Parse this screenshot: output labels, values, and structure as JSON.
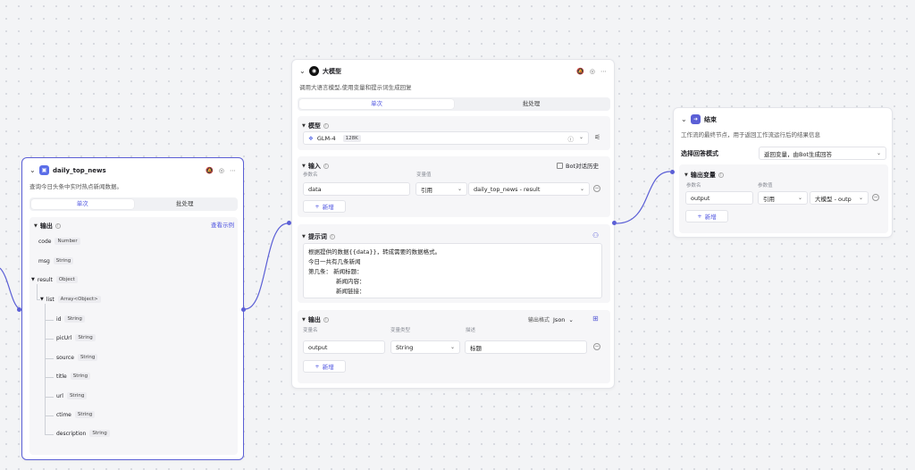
{
  "colors": {
    "accent": "#5b5fd6",
    "link": "#4d53e0",
    "edge": "#5b5fd6"
  },
  "node1": {
    "title": "daily_top_news",
    "icon": "plugin-icon",
    "desc": "查询今日头条中实时热点新闻数据。",
    "tabs": [
      "单次",
      "批处理"
    ],
    "output_title": "输出",
    "view_example": "查看示例",
    "fields": [
      {
        "name": "code",
        "type": "Number"
      },
      {
        "name": "msg",
        "type": "String"
      },
      {
        "name": "result",
        "type": "Object"
      },
      {
        "name": "list",
        "type": "Array<Object>"
      },
      {
        "name": "id",
        "type": "String"
      },
      {
        "name": "picUrl",
        "type": "String"
      },
      {
        "name": "source",
        "type": "String"
      },
      {
        "name": "title",
        "type": "String"
      },
      {
        "name": "url",
        "type": "String"
      },
      {
        "name": "ctime",
        "type": "String"
      },
      {
        "name": "description",
        "type": "String"
      }
    ]
  },
  "node2": {
    "title": "大模型",
    "desc": "调用大语言模型,使用变量和提示词生成回复",
    "tabs": [
      "单次",
      "批处理"
    ],
    "model_title": "模型",
    "model_name": "GLM-4",
    "model_ctx": "128K",
    "input_title": "输入",
    "bot_history": "Bot对话历史",
    "param_label": "参数名",
    "value_label": "变量值",
    "input_param": "data",
    "input_ref": "引用",
    "input_value": "daily_top_news - result",
    "add": "新增",
    "prompt_title": "提示词",
    "prompt_lines": [
      "根据提供的数据{{data}}，转成需要的数据格式。",
      "今日一共有几条新闻",
      "第几条： 新闻标题：",
      "新闻内容：",
      "新闻链接："
    ],
    "output_title": "输出",
    "output_format_label": "输出格式",
    "output_format": "Json",
    "var_label": "变量名",
    "type_label": "变量类型",
    "desc_label": "描述",
    "output_name": "output",
    "output_type": "String",
    "output_desc": "标题"
  },
  "node3": {
    "title": "结束",
    "desc": "工作流的最终节点，用于返回工作流运行后的结果信息",
    "mode_label": "选择回答模式",
    "mode_value": "返回变量，由Bot生成回答",
    "out_var_title": "输出变量",
    "param_label": "参数名",
    "value_label": "参数值",
    "param": "output",
    "ref": "引用",
    "value": "大模型 - outp",
    "add": "新增"
  }
}
